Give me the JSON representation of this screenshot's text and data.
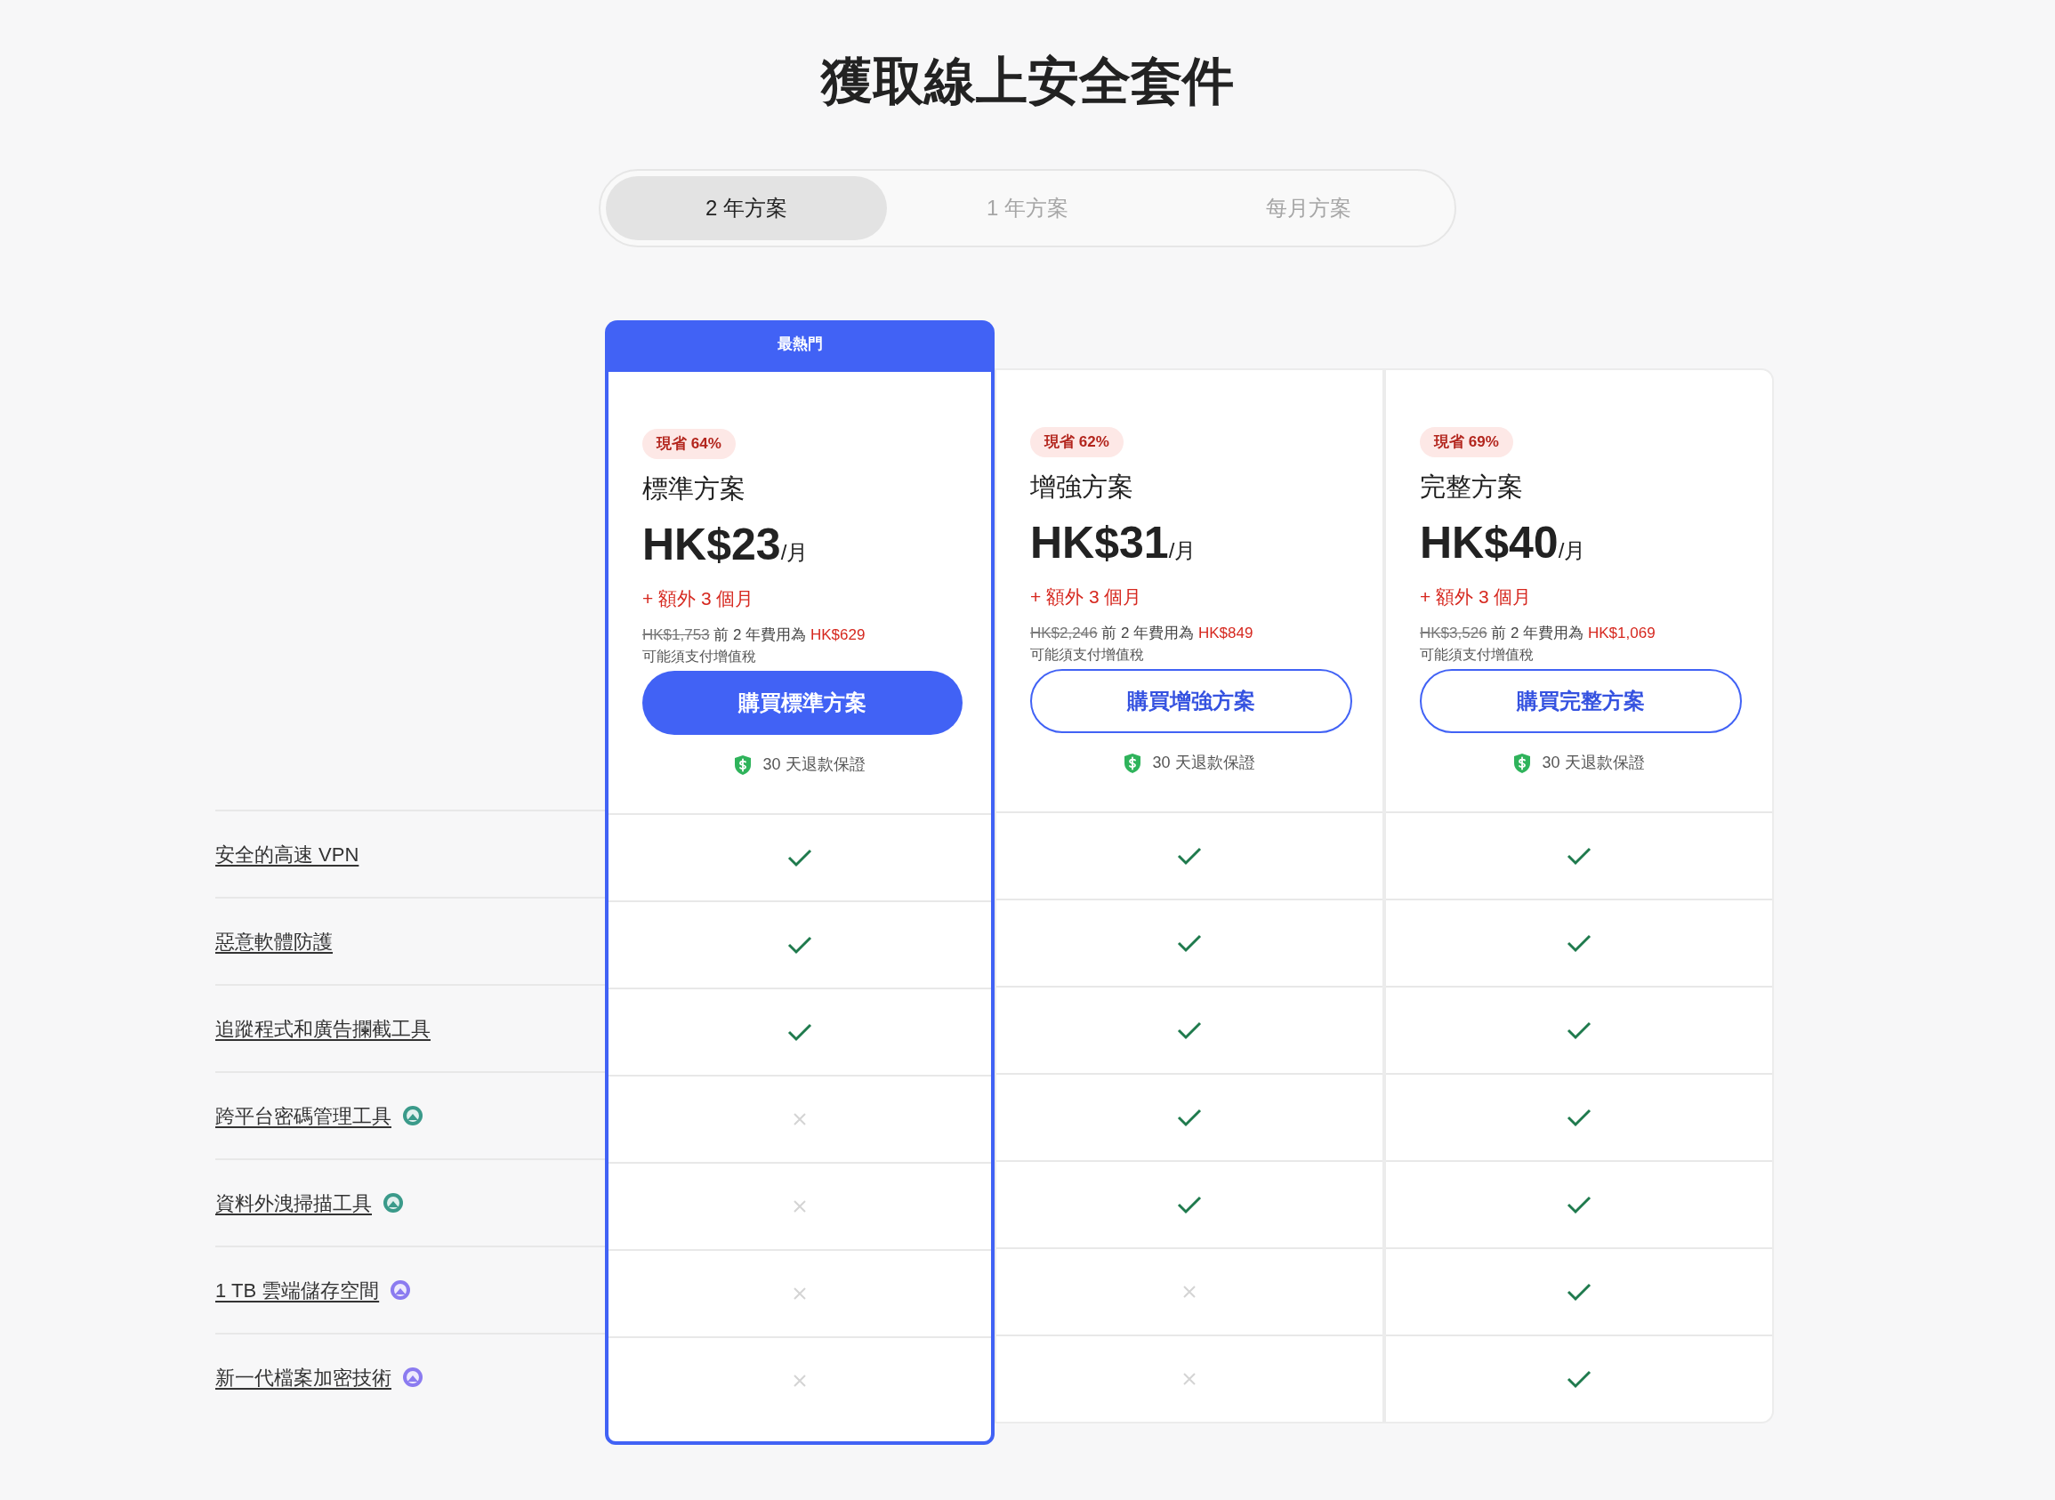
{
  "title": "獲取線上安全套件",
  "billing_tabs": [
    {
      "label": "2 年方案",
      "selected": true
    },
    {
      "label": "1 年方案",
      "selected": false
    },
    {
      "label": "每月方案",
      "selected": false
    }
  ],
  "plans": [
    {
      "ribbon": "最熱門",
      "popular": true,
      "discount": "現省 64%",
      "name": "標準方案",
      "price": "HK$23",
      "per": "/月",
      "extra": "+ 額外 3 個月",
      "original_price": "HK$1,753",
      "total_prefix": "前 2 年費用為",
      "total": "HK$629",
      "vat_note": "可能須支付增值稅",
      "button": "購買標準方案",
      "guarantee": "30 天退款保證"
    },
    {
      "popular": false,
      "discount": "現省 62%",
      "name": "增強方案",
      "price": "HK$31",
      "per": "/月",
      "extra": "+ 額外 3 個月",
      "original_price": "HK$2,246",
      "total_prefix": "前 2 年費用為",
      "total": "HK$849",
      "vat_note": "可能須支付增值稅",
      "button": "購買增強方案",
      "guarantee": "30 天退款保證"
    },
    {
      "popular": false,
      "discount": "現省 69%",
      "name": "完整方案",
      "price": "HK$40",
      "per": "/月",
      "extra": "+ 額外 3 個月",
      "original_price": "HK$3,526",
      "total_prefix": "前 2 年費用為",
      "total": "HK$1,069",
      "vat_note": "可能須支付增值稅",
      "button": "購買完整方案",
      "guarantee": "30 天退款保證"
    }
  ],
  "features": [
    {
      "label": "安全的高速 VPN",
      "included": [
        true,
        true,
        true
      ]
    },
    {
      "label": "惡意軟體防護",
      "included": [
        true,
        true,
        true
      ]
    },
    {
      "label": "追蹤程式和廣告攔截工具",
      "included": [
        true,
        true,
        true
      ]
    },
    {
      "label": "跨平台密碼管理工具",
      "color": "#3a9a8a",
      "included": [
        false,
        true,
        true
      ]
    },
    {
      "label": "資料外洩掃描工具",
      "color": "#3a9a8a",
      "included": [
        false,
        true,
        true
      ]
    },
    {
      "label": "1 TB 雲端儲存空間",
      "color": "#8b7bf0",
      "included": [
        false,
        false,
        true
      ]
    },
    {
      "label": "新一代檔案加密技術",
      "color": "#8b7bf0",
      "included": [
        false,
        false,
        true
      ]
    }
  ]
}
